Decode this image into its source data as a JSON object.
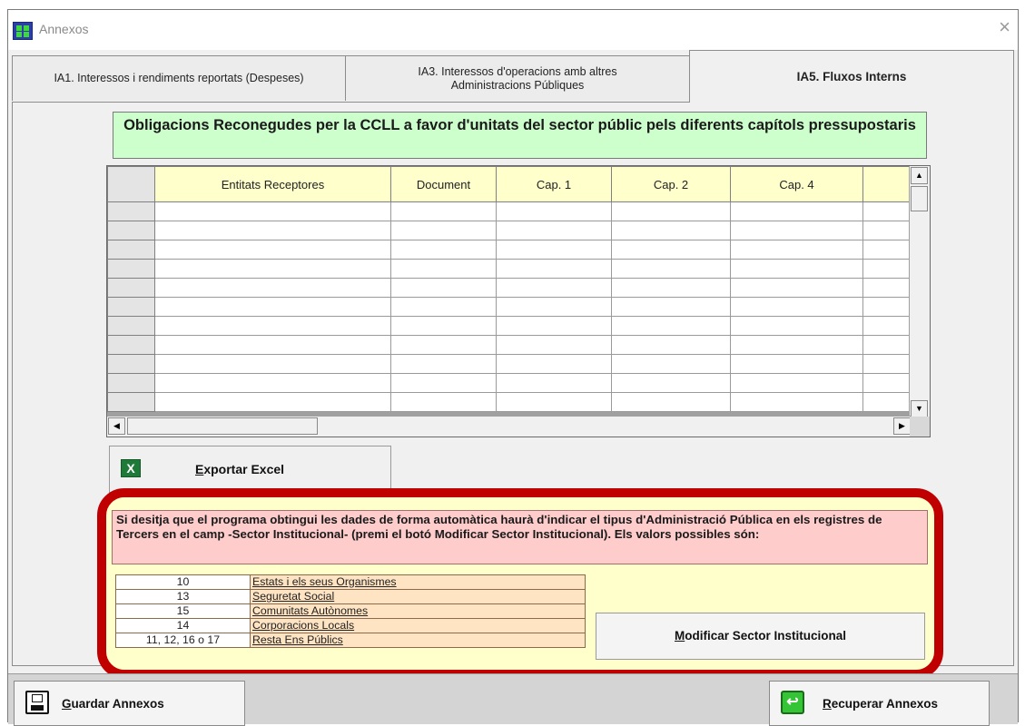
{
  "window": {
    "title": "Annexos",
    "close_glyph": "×"
  },
  "tabs": [
    {
      "label": "IA1. Interessos i rendiments reportats (Despeses)",
      "active": false
    },
    {
      "label": "IA3. Interessos d'operacions amb altres Administracions Públiques",
      "active": false
    },
    {
      "label": "IA5. Fluxos Interns",
      "active": true
    }
  ],
  "header": {
    "text": "Obligacions Reconegudes per la CCLL a favor d'unitats del sector públic pels diferents capítols pressupostaris"
  },
  "grid": {
    "columns": [
      "Entitats Receptores",
      "Document",
      "Cap. 1",
      "Cap. 2",
      "Cap. 4",
      ""
    ],
    "row_count": 11
  },
  "export": {
    "label_accel": "E",
    "label_rest": "xportar Excel",
    "icon": "excel-icon",
    "icon_glyph": "X"
  },
  "info": {
    "note": "Si desitja que el programa obtingui les dades de forma automàtica haurà d'indicar el tipus d'Administració Pública en els registres de Tercers en el camp -Sector Institucional- (premi el botó Modificar Sector Institucional). Els valors possibles són:",
    "codes": [
      {
        "code": "10",
        "desc": "Estats i els seus Organismes"
      },
      {
        "code": "13",
        "desc": "Seguretat Social"
      },
      {
        "code": "15",
        "desc": "Comunitats Autònomes"
      },
      {
        "code": "14",
        "desc": "Corporacions Locals"
      },
      {
        "code": "11, 12, 16 o 17",
        "desc": "Resta Ens Públics"
      }
    ],
    "modify_accel": "M",
    "modify_rest": "odificar Sector Institucional"
  },
  "footer": {
    "save_accel": "G",
    "save_rest": "uardar Annexos",
    "recover_accel": "R",
    "recover_rest": "ecuperar Annexos",
    "recover_glyph": "↩"
  },
  "colors": {
    "header_bg": "#ccffcc",
    "column_header_bg": "#ffffcc",
    "note_bg": "#ffcccc",
    "highlight_border": "#c00000"
  }
}
